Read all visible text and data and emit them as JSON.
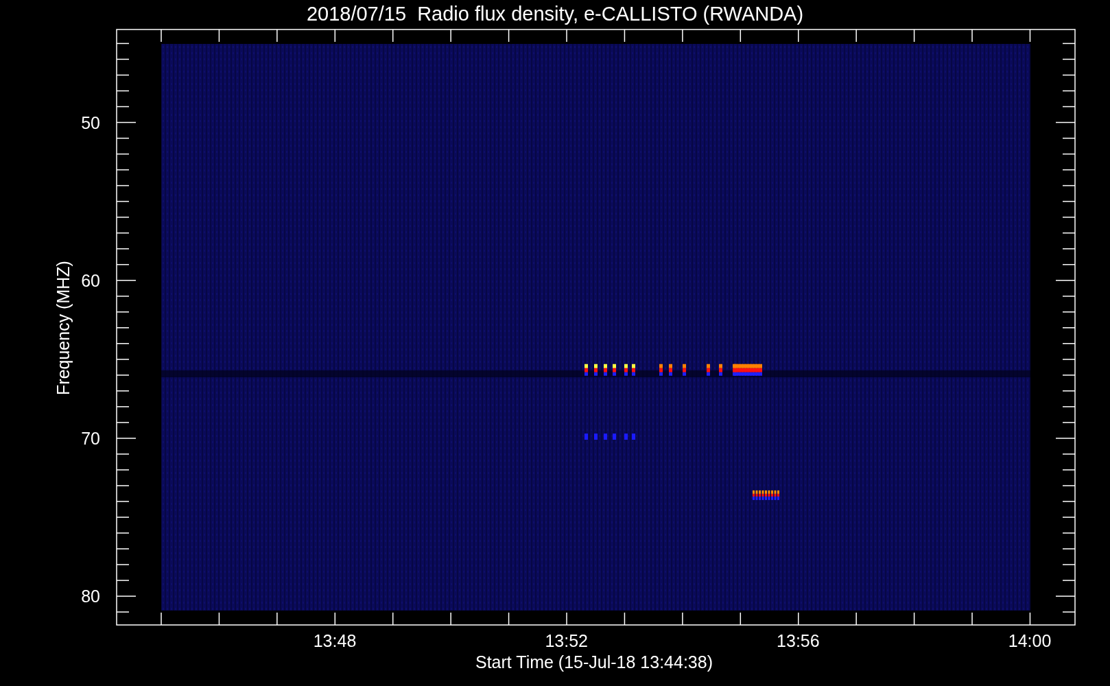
{
  "title": "2018/07/15  Radio flux density, e-CALLISTO (RWANDA)",
  "x_axis": {
    "label": "Start Time (15-Jul-18 13:44:38)",
    "ticks": [
      "13:48",
      "13:52",
      "13:56",
      "14:00"
    ]
  },
  "y_axis": {
    "label": "Frequency (MHZ)",
    "ticks": [
      "50",
      "60",
      "70",
      "80"
    ]
  }
}
